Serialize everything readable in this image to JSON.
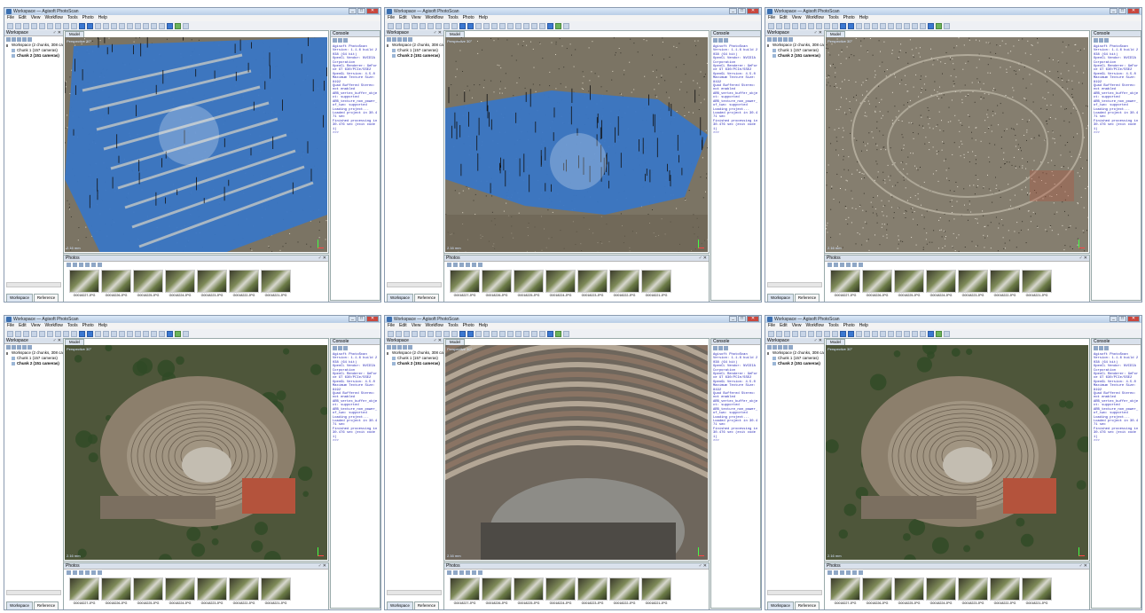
{
  "app": {
    "window_title": "Workspace — Agisoft PhotoScan",
    "menus": [
      "File",
      "Edit",
      "View",
      "Workflow",
      "Tools",
      "Photo",
      "Help"
    ],
    "win_minimize": "_",
    "win_maximize": "□",
    "win_close": "✕"
  },
  "workspace": {
    "title": "Workspace",
    "controls": "♂ ✕",
    "root": "Workspace (2 chunks, 308 cameras)",
    "chunks": [
      "Chunk 1 (157 cameras)",
      "Chunk 2 (151 cameras)"
    ],
    "tabs": [
      "Workspace",
      "Reference"
    ]
  },
  "model": {
    "tab": "Model",
    "projection": "Perspective 30°",
    "scale": "2.16 mm"
  },
  "console": {
    "title": "Console",
    "text": "Agisoft PhotoScan\nVersion: 1.1.6 build 2038 (64 bit)\nOpenCL Vendor: NVIDIA Corporation\nOpenCL Renderer: GeForce GT 630/PCIe/SSE2\nOpenGL Version: 4.5.0\nMaximum Texture Size: 8192\nQuad Buffered Stereo: not enabled\nARB_vertex_buffer_object: supported\nARB_texture_non_power_of_two: supported\nLoading project...\nLoaded project in 30.471 sec\nFinished processing in 30.476 sec (exit code 1)\n>>>"
  },
  "photos": {
    "title": "Photos",
    "controls": "♂ ✕",
    "thumbnails": [
      "G0018227.JPG",
      "G0018226.JPG",
      "G0018225.JPG",
      "G0018224.JPG",
      "G0018223.JPG",
      "G0018222.JPG",
      "G0018221.JPG"
    ]
  },
  "panes": [
    {
      "name": "tie-points-top"
    },
    {
      "name": "tie-points-oblique"
    },
    {
      "name": "dense-cloud-top"
    },
    {
      "name": "textured-model-oblique"
    },
    {
      "name": "textured-model-closeup"
    },
    {
      "name": "textured-model-top"
    }
  ],
  "colors": {
    "camera_plane": "#3a76c4",
    "console_text": "#1f1fb4",
    "terracotta_roof": "#b4533c"
  }
}
